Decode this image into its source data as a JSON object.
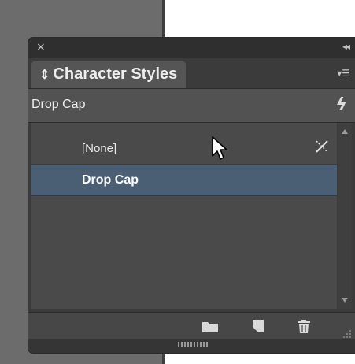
{
  "panel": {
    "close_icon": "close-icon",
    "collapse_icon": "double-chevron-left-icon",
    "tab_arrows": "⇕",
    "title": "Character Styles",
    "menu_icon": "panel-menu-icon",
    "current_style": "Drop Cap",
    "quick_apply_icon": "lightning-icon"
  },
  "styles": [
    {
      "label": "[None]"
    },
    {
      "label": "Drop Cap",
      "selected": true
    }
  ],
  "footer": {
    "folder_icon": "folder-icon",
    "new_style_icon": "new-style-icon",
    "trash_icon": "trash-icon"
  },
  "colors": {
    "panel_bg": "#3b3b3b",
    "selected_row": "#4b5f74"
  }
}
